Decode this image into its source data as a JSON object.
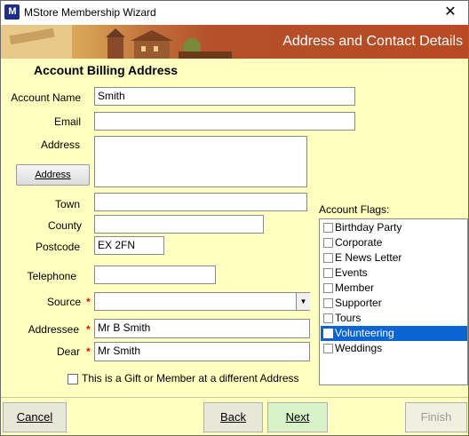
{
  "window": {
    "app_icon": "M",
    "title": "MStore Membership Wizard",
    "close_label": "✕"
  },
  "banner": {
    "title": "Address and Contact Details"
  },
  "form": {
    "section_title": "Account Billing Address",
    "account_name": {
      "label": "Account Name",
      "value": "Smith"
    },
    "email": {
      "label": "Email",
      "value": ""
    },
    "address": {
      "label": "Address",
      "value": "",
      "button_label": "Address"
    },
    "town": {
      "label": "Town",
      "value": ""
    },
    "county": {
      "label": "County",
      "value": ""
    },
    "postcode": {
      "label": "Postcode",
      "value": "EX 2FN"
    },
    "telephone": {
      "label": "Telephone",
      "value": ""
    },
    "source": {
      "label": "Source",
      "required": "*",
      "value": ""
    },
    "addressee": {
      "label": "Addressee",
      "required": "*",
      "value": "Mr B Smith"
    },
    "dear": {
      "label": "Dear",
      "required": "*",
      "value": "Mr Smith"
    },
    "gift_checkbox_label": "This is a Gift or Member at a different Address"
  },
  "flags": {
    "label": "Account Flags:",
    "items": [
      {
        "label": "Birthday Party",
        "checked": false,
        "selected": false
      },
      {
        "label": "Corporate",
        "checked": false,
        "selected": false
      },
      {
        "label": "E News Letter",
        "checked": false,
        "selected": false
      },
      {
        "label": "Events",
        "checked": false,
        "selected": false
      },
      {
        "label": "Member",
        "checked": false,
        "selected": false
      },
      {
        "label": "Supporter",
        "checked": false,
        "selected": false
      },
      {
        "label": "Tours",
        "checked": false,
        "selected": false
      },
      {
        "label": "Volunteering",
        "checked": false,
        "selected": true
      },
      {
        "label": "Weddings",
        "checked": false,
        "selected": false
      }
    ]
  },
  "footer": {
    "cancel": "Cancel",
    "back": "Back",
    "next": "Next",
    "finish": "Finish"
  },
  "colors": {
    "background": "#ffffc0",
    "banner": "#b84a23",
    "selection": "#0a64d2",
    "required": "#e01010",
    "next_button": "#d8f3c8"
  }
}
